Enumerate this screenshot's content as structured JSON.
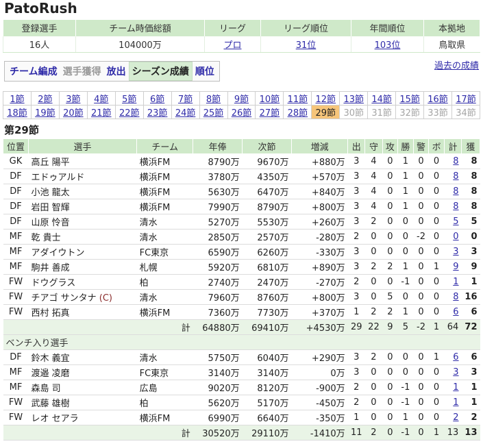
{
  "title": "PatoRush",
  "summary": {
    "headers": [
      "登録選手",
      "チーム時価総額",
      "リーグ",
      "リーグ順位",
      "年間順位",
      "本拠地"
    ],
    "values": [
      "16人",
      "104000万",
      "プロ",
      "31位",
      "103位",
      "鳥取県"
    ]
  },
  "menu": {
    "items": [
      {
        "label": "チーム編成",
        "state": "link"
      },
      {
        "label": "選手獲得",
        "state": "disabled"
      },
      {
        "label": "放出",
        "state": "link"
      },
      {
        "label": "シーズン成績",
        "state": "active"
      },
      {
        "label": "順位",
        "state": "link"
      }
    ],
    "past_label": "過去の成績"
  },
  "rounds": {
    "row1": [
      "1節",
      "2節",
      "3節",
      "4節",
      "5節",
      "6節",
      "7節",
      "8節",
      "9節",
      "10節",
      "11節",
      "12節",
      "13節",
      "14節",
      "15節",
      "16節",
      "17節"
    ],
    "row2": [
      "18節",
      "19節",
      "20節",
      "21節",
      "22節",
      "23節",
      "24節",
      "25節",
      "26節",
      "27節",
      "28節",
      "29節",
      "30節",
      "31節",
      "32節",
      "33節",
      "34節"
    ],
    "current": "29節",
    "future_from": 30
  },
  "section_title": "第29節",
  "table": {
    "headers": [
      "位置",
      "選手",
      "チーム",
      "年俸",
      "次節",
      "増減",
      "出",
      "守",
      "攻",
      "勝",
      "警",
      "ボ",
      "計",
      "獲"
    ],
    "starters": [
      [
        "GK",
        "高丘 陽平",
        "横浜FM",
        "8790万",
        "9670万",
        "+880万",
        "3",
        "4",
        "0",
        "1",
        "0",
        "0",
        "8",
        "8"
      ],
      [
        "DF",
        "エドゥアルド",
        "横浜FM",
        "3780万",
        "4350万",
        "+570万",
        "3",
        "4",
        "0",
        "1",
        "0",
        "0",
        "8",
        "8"
      ],
      [
        "DF",
        "小池 龍太",
        "横浜FM",
        "5630万",
        "6470万",
        "+840万",
        "3",
        "4",
        "0",
        "1",
        "0",
        "0",
        "8",
        "8"
      ],
      [
        "DF",
        "岩田 智輝",
        "横浜FM",
        "7990万",
        "8790万",
        "+800万",
        "3",
        "4",
        "0",
        "1",
        "0",
        "0",
        "8",
        "8"
      ],
      [
        "DF",
        "山原 怜音",
        "清水",
        "5270万",
        "5530万",
        "+260万",
        "3",
        "2",
        "0",
        "0",
        "0",
        "0",
        "5",
        "5"
      ],
      [
        "MF",
        "乾 貴士",
        "清水",
        "2850万",
        "2570万",
        "-280万",
        "2",
        "0",
        "0",
        "0",
        "-2",
        "0",
        "0",
        "0"
      ],
      [
        "MF",
        "アダイウトン",
        "FC東京",
        "6590万",
        "6260万",
        "-330万",
        "3",
        "0",
        "0",
        "0",
        "0",
        "0",
        "3",
        "3"
      ],
      [
        "MF",
        "駒井 善成",
        "札幌",
        "5920万",
        "6810万",
        "+890万",
        "3",
        "2",
        "2",
        "1",
        "0",
        "1",
        "9",
        "9"
      ],
      [
        "FW",
        "ドウグラス",
        "柏",
        "2740万",
        "2470万",
        "-270万",
        "2",
        "0",
        "0",
        "-1",
        "0",
        "0",
        "1",
        "1"
      ],
      [
        "FW",
        "チアゴ サンタナ",
        "清水",
        "7960万",
        "8760万",
        "+800万",
        "3",
        "0",
        "5",
        "0",
        "0",
        "0",
        "8",
        "16"
      ],
      [
        "FW",
        "西村 拓真",
        "横浜FM",
        "7360万",
        "7730万",
        "+370万",
        "1",
        "2",
        "2",
        "1",
        "0",
        "0",
        "6",
        "6"
      ]
    ],
    "captain_index": 9,
    "captain_mark": "(C)",
    "starters_total": [
      "計",
      "64880万",
      "69410万",
      "+4530万",
      "29",
      "22",
      "9",
      "5",
      "-2",
      "1",
      "64",
      "72"
    ],
    "bench_label": "ベンチ入り選手",
    "bench": [
      [
        "DF",
        "鈴木 義宜",
        "清水",
        "5750万",
        "6040万",
        "+290万",
        "3",
        "2",
        "0",
        "0",
        "0",
        "1",
        "6",
        "6"
      ],
      [
        "MF",
        "渡邉 凌磨",
        "FC東京",
        "3140万",
        "3140万",
        "0万",
        "3",
        "0",
        "0",
        "0",
        "0",
        "0",
        "3",
        "3"
      ],
      [
        "MF",
        "森島 司",
        "広島",
        "9020万",
        "8120万",
        "-900万",
        "2",
        "0",
        "0",
        "-1",
        "0",
        "0",
        "1",
        "1"
      ],
      [
        "FW",
        "武藤 雄樹",
        "柏",
        "5620万",
        "5170万",
        "-450万",
        "2",
        "0",
        "0",
        "-1",
        "0",
        "0",
        "1",
        "1"
      ],
      [
        "FW",
        "レオ セアラ",
        "横浜FM",
        "6990万",
        "6640万",
        "-350万",
        "1",
        "0",
        "0",
        "1",
        "0",
        "0",
        "2",
        "2"
      ]
    ],
    "bench_total": [
      "計",
      "30520万",
      "29110万",
      "-1410万",
      "11",
      "2",
      "0",
      "-1",
      "0",
      "1",
      "13",
      "13"
    ]
  }
}
